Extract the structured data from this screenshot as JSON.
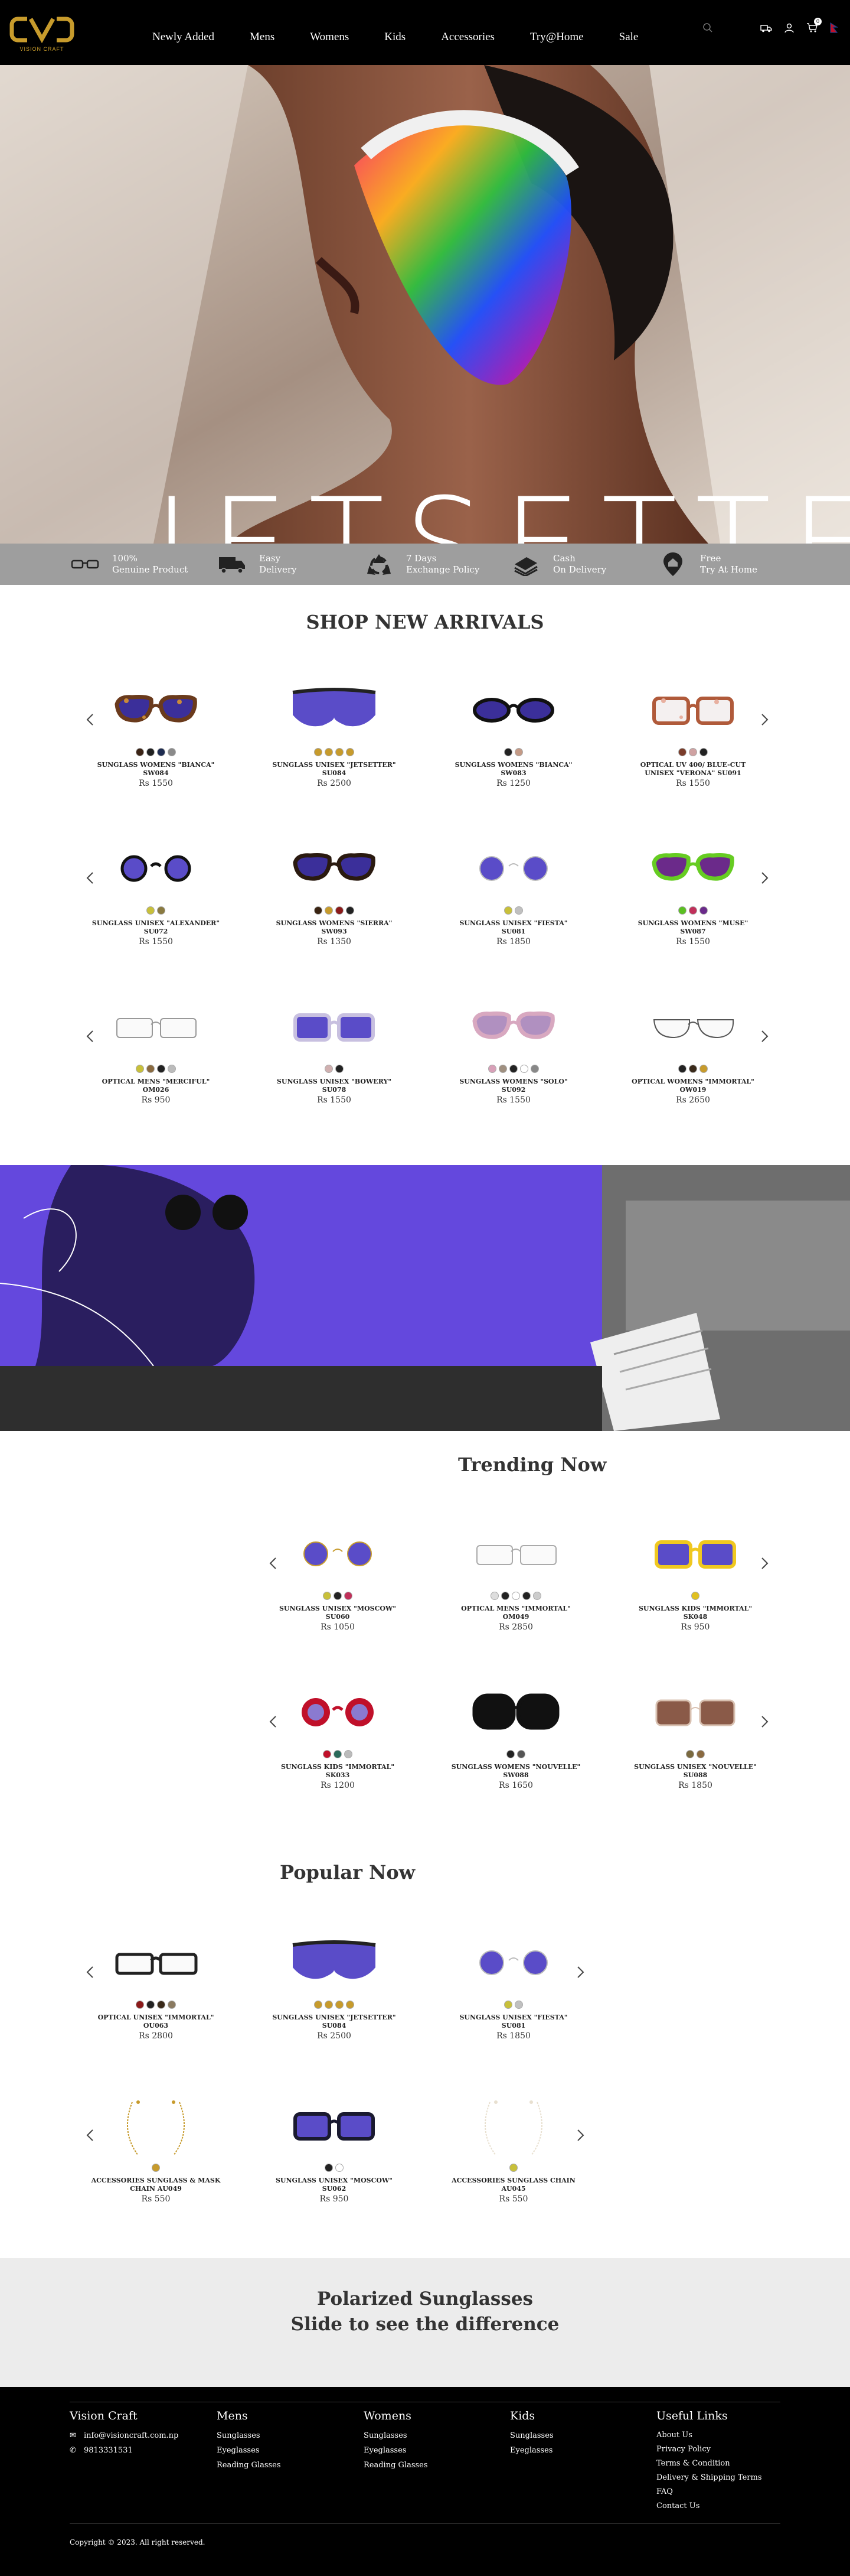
{
  "brand": {
    "logo_text": "CVC",
    "tagline": "VISION CRAFT",
    "gold": "#c79b2c"
  },
  "nav": {
    "items": [
      "Newly Added",
      "Mens",
      "Womens",
      "Kids",
      "Accessories",
      "Try@Home",
      "Sale"
    ],
    "icons": [
      "search-icon",
      "delivery-icon",
      "user-icon",
      "cart-icon",
      "nepal-flag-icon"
    ],
    "cart_count": "0"
  },
  "hero": {
    "title": "JETSETTER"
  },
  "features": [
    {
      "icon": "glasses-icon",
      "line1": "100%",
      "line2": "Genuine Product"
    },
    {
      "icon": "truck-icon",
      "line1": "Easy",
      "line2": "Delivery"
    },
    {
      "icon": "recycle-icon",
      "line1": "7 Days",
      "line2": "Exchange Policy"
    },
    {
      "icon": "cash-icon",
      "line1": "Cash",
      "line2": "On Delivery"
    },
    {
      "icon": "home-pin-icon",
      "line1": "Free",
      "line2": "Try At Home"
    }
  ],
  "new_arrivals": {
    "title": "SHOP NEW ARRIVALS",
    "rows": [
      [
        {
          "name": "SUNGLASS WOMENS \"BIANCA\" SW084",
          "price": "Rs 1550",
          "style": "cat-tortoise",
          "colors": [
            "#3b2416",
            "#202020",
            "#1d2b50",
            "#8a8a8a"
          ]
        },
        {
          "name": "SUNGLASS UNISEX \"JETSETTER\" SU084",
          "price": "Rs 2500",
          "style": "shield-purple",
          "colors": [
            "#c79b2c",
            "#c79b2c",
            "#c79b2c",
            "#c79b2c"
          ]
        },
        {
          "name": "SUNGLASS WOMENS \"BIANCA\" SW083",
          "price": "Rs 1250",
          "style": "oval-black",
          "colors": [
            "#222222",
            "#c49a86"
          ]
        },
        {
          "name": "OPTICAL UV 400/ BLUE-CUT UNISEX \"VERONA\" SU091",
          "price": "Rs 1550",
          "style": "square-tortoise-optical",
          "colors": [
            "#7a3c2a",
            "#cfa2a2",
            "#222222"
          ]
        }
      ],
      [
        {
          "name": "SUNGLASS UNISEX \"ALEXANDER\" SU072",
          "price": "Rs 1550",
          "style": "round-black",
          "colors": [
            "#c8c03a",
            "#8a7a40"
          ]
        },
        {
          "name": "SUNGLASS WOMENS \"SIERRA\" SW093",
          "price": "Rs 1350",
          "style": "cat-brown",
          "colors": [
            "#3a2412",
            "#c79b2c",
            "#8b1a1a",
            "#222222"
          ]
        },
        {
          "name": "SUNGLASS UNISEX \"FIESTA\" SU081",
          "price": "Rs 1850",
          "style": "round-silver",
          "colors": [
            "#c8c03a",
            "#c0c0c0"
          ]
        },
        {
          "name": "SUNGLASS WOMENS \"MUSE\" SW087",
          "price": "Rs 1550",
          "style": "cat-green",
          "colors": [
            "#5bbf22",
            "#c0305a",
            "#6a2a8a"
          ]
        }
      ],
      [
        {
          "name": "OPTICAL MENS \"MERCIFUL\" OM026",
          "price": "Rs 950",
          "style": "rect-optical-clear",
          "colors": [
            "#c8c03a",
            "#8a6a40",
            "#222222",
            "#bbbbbb"
          ]
        },
        {
          "name": "SUNGLASS UNISEX \"BOWERY\" SU078",
          "price": "Rs 1550",
          "style": "square-clear-purple",
          "colors": [
            "#d0b0b0",
            "#222222"
          ]
        },
        {
          "name": "SUNGLASS WOMENS \"SOLO\" SU092",
          "price": "Rs 1550",
          "style": "cat-pink",
          "colors": [
            "#d8a0b8",
            "#a09080",
            "#222222",
            "#ffffff",
            "#888888"
          ]
        },
        {
          "name": "OPTICAL WOMENS \"IMMORTAL\" OW019",
          "price": "Rs 2650",
          "style": "aviator-optical",
          "colors": [
            "#222222",
            "#3a2a1a",
            "#c79b2c"
          ]
        }
      ]
    ]
  },
  "trending": {
    "title": "Trending Now",
    "rows": [
      [
        {
          "name": "SUNGLASS UNISEX \"MOSCOW\" SU060",
          "price": "Rs 1050",
          "style": "round-gold",
          "colors": [
            "#c8c03a",
            "#222222",
            "#c0305a"
          ]
        },
        {
          "name": "OPTICAL MENS \"IMMORTAL\" OM049",
          "price": "Rs 2850",
          "style": "rect-optical-silver",
          "colors": [
            "#dddddd",
            "#222222",
            "#ffffff",
            "#222222",
            "#cccccc"
          ]
        },
        {
          "name": "SUNGLASS KIDS \"IMMORTAL\" SK048",
          "price": "Rs 950",
          "style": "square-yellow",
          "colors": [
            "#e0c020"
          ]
        }
      ],
      [
        {
          "name": "SUNGLASS KIDS \"IMMORTAL\" SK033",
          "price": "Rs 1200",
          "style": "flower-red",
          "colors": [
            "#c0102a",
            "#2a6a5a",
            "#bbbbbb"
          ]
        },
        {
          "name": "SUNGLASS WOMENS \"NOUVELLE\" SW088",
          "price": "Rs 1650",
          "style": "oversize-black",
          "colors": [
            "#222222",
            "#555555"
          ]
        },
        {
          "name": "SUNGLASS UNISEX \"NOUVELLE\" SU088",
          "price": "Rs 1850",
          "style": "square-brown-gradient",
          "colors": [
            "#7a6a40",
            "#8a6a40"
          ]
        }
      ]
    ]
  },
  "popular": {
    "title": "Popular Now",
    "rows": [
      [
        {
          "name": "OPTICAL UNISEX \"IMMORTAL\" OU063",
          "price": "Rs 2800",
          "style": "rect-optical-black",
          "colors": [
            "#8b1a1a",
            "#222222",
            "#3a2a1a",
            "#8a7a60"
          ]
        },
        {
          "name": "SUNGLASS UNISEX \"JETSETTER\" SU084",
          "price": "Rs 2500",
          "style": "shield-purple",
          "colors": [
            "#c79b2c",
            "#c79b2c",
            "#c79b2c",
            "#c79b2c"
          ]
        },
        {
          "name": "SUNGLASS UNISEX \"FIESTA\" SU081",
          "price": "Rs 1850",
          "style": "round-silver",
          "colors": [
            "#c8c03a",
            "#c0c0c0"
          ]
        }
      ],
      [
        {
          "name": "ACCESSORIES SUNGLASS & MASK CHAIN AU049",
          "price": "Rs 550",
          "style": "chain-gold",
          "colors": [
            "#c79b2c"
          ]
        },
        {
          "name": "SUNGLASS UNISEX \"MOSCOW\" SU062",
          "price": "Rs 950",
          "style": "square-navy",
          "colors": [
            "#222222",
            "#ffffff"
          ]
        },
        {
          "name": "ACCESSORIES SUNGLASS CHAIN AU045",
          "price": "Rs 550",
          "style": "chain-pearl",
          "colors": [
            "#c8c03a"
          ]
        }
      ]
    ]
  },
  "polarized": {
    "line1": "Polarized Sunglasses",
    "line2": "Slide to see the difference"
  },
  "footer": {
    "brand": "Vision Craft",
    "email": "info@visioncraft.com.np",
    "phone": "9813331531",
    "mens": {
      "title": "Mens",
      "links": [
        "Sunglasses",
        "Eyeglasses",
        "Reading Glasses"
      ]
    },
    "womens": {
      "title": "Womens",
      "links": [
        "Sunglasses",
        "Eyeglasses",
        "Reading Glasses"
      ]
    },
    "kids": {
      "title": "Kids",
      "links": [
        "Sunglasses",
        "Eyeglasses"
      ]
    },
    "useful": {
      "title": "Useful Links",
      "links": [
        "About Us",
        "Privacy Policy",
        "Terms & Condition",
        "Delivery & Shipping Terms",
        "FAQ",
        "Contact Us"
      ]
    },
    "copyright": "Copyright © 2023. All right reserved."
  }
}
